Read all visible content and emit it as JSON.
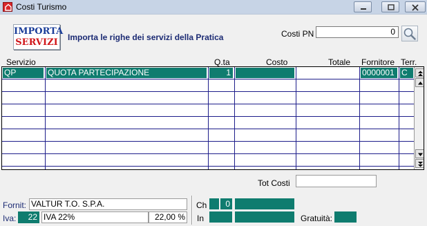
{
  "window": {
    "title": "Costi Turismo"
  },
  "toolbar": {
    "import_line1": "IMPORTA",
    "import_line2": "SERVIZI",
    "import_caption": "Importa le righe dei servizi della Pratica",
    "costi_pn_label": "Costi PN",
    "costi_pn_value": "0"
  },
  "grid": {
    "headers": [
      "Servizio",
      "Q.ta",
      "Costo",
      "Totale",
      "Fornitore",
      "Terr."
    ],
    "rows": [
      {
        "servizio": "QP",
        "descrizione": "QUOTA PARTECIPAZIONE",
        "qta": "1",
        "costo": "",
        "totale": "",
        "fornitore": "0000001",
        "terr": "C"
      }
    ]
  },
  "totals": {
    "tot_costi_label": "Tot Costi",
    "tot_costi_value": ""
  },
  "footer": {
    "fornit_label": "Fornit:",
    "fornit_value": "VALTUR T.O. S.P.A.",
    "iva_label": "Iva:",
    "iva_code": "22",
    "iva_desc": "IVA 22%",
    "iva_perc": "22,00 %",
    "ch_label": "Ch",
    "ch_value": "0",
    "in_label": "In",
    "gratuita_label": "Gratuità:"
  },
  "colors": {
    "selection": "#0f7c6f",
    "grid_lines": "#1d1d8a",
    "caption": "#1b2a73"
  }
}
